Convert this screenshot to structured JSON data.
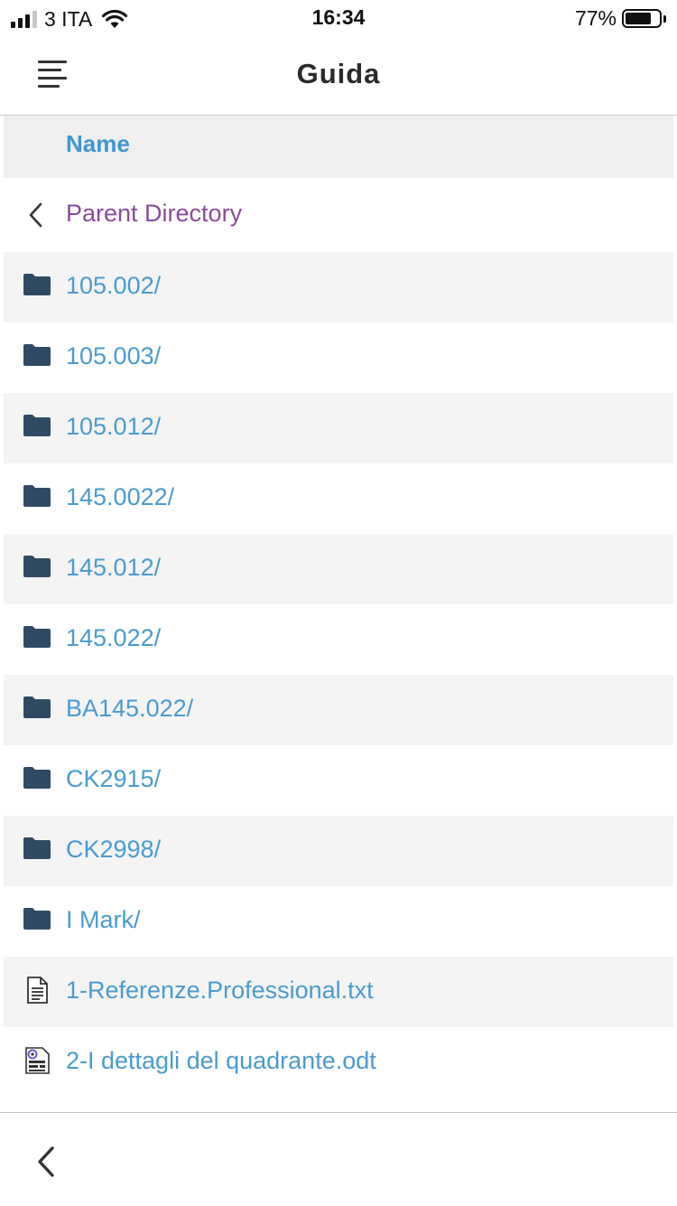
{
  "status_bar": {
    "carrier": "3 ITA",
    "time": "16:34",
    "battery_percent": "77%",
    "battery_level": 0.77,
    "signal_bars_active": 3,
    "signal_bars_total": 4
  },
  "nav": {
    "title": "Guida",
    "menu_icon": "hamburger-menu-icon"
  },
  "listing": {
    "column_header": "Name",
    "parent_label": "Parent Directory",
    "items": [
      {
        "name": "105.002/",
        "type": "folder"
      },
      {
        "name": "105.003/",
        "type": "folder"
      },
      {
        "name": "105.012/",
        "type": "folder"
      },
      {
        "name": "145.0022/",
        "type": "folder"
      },
      {
        "name": "145.012/",
        "type": "folder"
      },
      {
        "name": "145.022/",
        "type": "folder"
      },
      {
        "name": "BA145.022/",
        "type": "folder"
      },
      {
        "name": "CK2915/",
        "type": "folder"
      },
      {
        "name": "CK2998/",
        "type": "folder"
      },
      {
        "name": "I Mark/",
        "type": "folder"
      },
      {
        "name": "1-Referenze.Professional.txt",
        "type": "text-file"
      },
      {
        "name": "2-I dettagli del quadrante.odt",
        "type": "document-file"
      }
    ]
  },
  "colors": {
    "link": "#4a9bcf",
    "header_link": "#3f97d1",
    "visited": "#8a4b9c",
    "folder_icon": "#2f4a64",
    "row_alt_bg": "#f4f4f4",
    "header_bg": "#efefef"
  }
}
